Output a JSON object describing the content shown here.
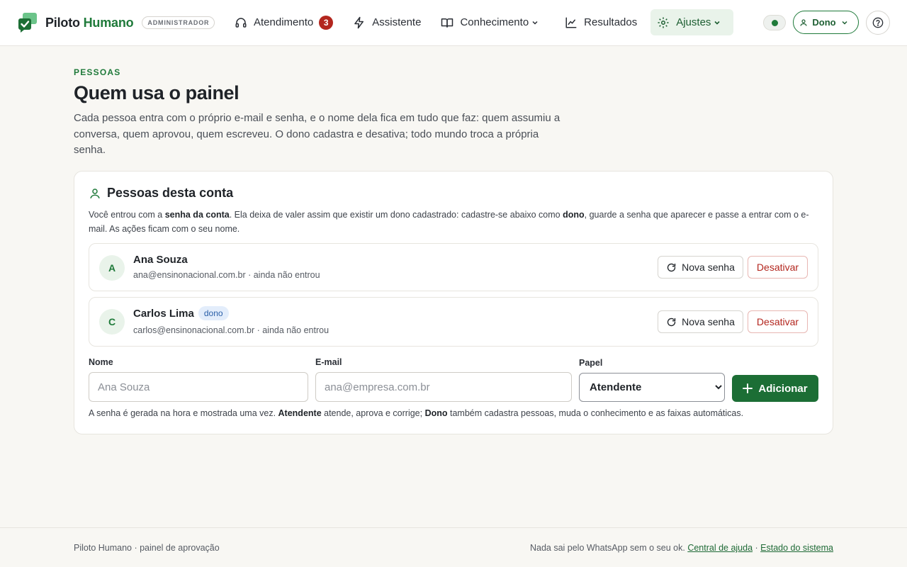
{
  "brand": {
    "name_part1": "Piloto",
    "name_part2": "Humano",
    "role_badge": "ADMINISTRADOR"
  },
  "nav": {
    "items": [
      {
        "label": "Atendimento",
        "icon": "headset-icon",
        "badge": "3"
      },
      {
        "label": "Assistente",
        "icon": "lightning-icon"
      },
      {
        "label": "Conhecimento",
        "icon": "book-icon",
        "dropdown": true
      },
      {
        "label": "Resultados",
        "icon": "line-chart-icon"
      },
      {
        "label": "Ajustes",
        "icon": "gear-icon",
        "dropdown": true,
        "active": true
      }
    ]
  },
  "topbar": {
    "user_label": "Dono"
  },
  "header": {
    "eyebrow": "PESSOAS",
    "title": "Quem usa o painel",
    "description": "Cada pessoa entra com o próprio e-mail e senha, e o nome dela fica em tudo que faz: quem assumiu a conversa, quem aprovou, quem escreveu. O dono cadastra e desativa; todo mundo troca a própria senha."
  },
  "card": {
    "title": "Pessoas desta conta",
    "note": {
      "p1": "Você entrou com a ",
      "b1": "senha da conta",
      "p2": ". Ela deixa de valer assim que existir um dono cadastrado: cadastre-se abaixo como ",
      "b2": "dono",
      "p3": ", guarde a senha que aparecer e passe a entrar com o e-mail. As ações ficam com o seu nome."
    },
    "people": [
      {
        "initial": "A",
        "name": "Ana Souza",
        "role_tag": "",
        "meta": "ana@ensinonacional.com.br · ainda não entrou",
        "reset_label": "Nova senha",
        "deactivate_label": "Desativar"
      },
      {
        "initial": "C",
        "name": "Carlos Lima",
        "role_tag": "dono",
        "meta": "carlos@ensinonacional.com.br · ainda não entrou",
        "reset_label": "Nova senha",
        "deactivate_label": "Desativar"
      }
    ],
    "form": {
      "name_label": "Nome",
      "name_placeholder": "Ana Souza",
      "email_label": "E-mail",
      "email_placeholder": "ana@empresa.com.br",
      "role_label": "Papel",
      "role_selected": "Atendente",
      "add_label": "Adicionar"
    },
    "hint": {
      "p1": "A senha é gerada na hora e mostrada uma vez. ",
      "b1": "Atendente",
      "p2": " atende, aprova e corrige; ",
      "b2": "Dono",
      "p3": " também cadastra pessoas, muda o conhecimento e as faixas automáticas."
    }
  },
  "footer": {
    "left": "Piloto Humano · painel de aprovação",
    "right_text": "Nada sai pelo WhatsApp sem o seu ok. ",
    "link_help": "Central de ajuda",
    "separator": " · ",
    "link_status": "Estado do sistema"
  },
  "colors": {
    "brand_green": "#1f7a3a",
    "danger": "#b3261e",
    "background": "#f8f7f3"
  }
}
